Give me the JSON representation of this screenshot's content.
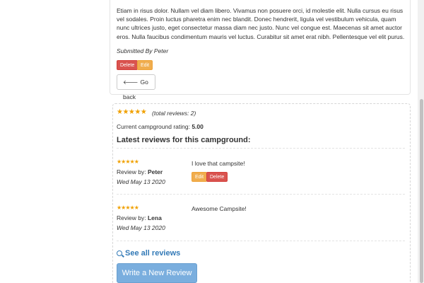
{
  "campground": {
    "description": "Etiam in risus dolor. Nullam vel diam libero. Vivamus non posuere orci, id molestie elit. Nulla cursus eu risus vel sodales. Proin luctus pharetra enim nec blandit. Donec hendrerit, ligula vel vestibulum vehicula, quam nunc ultrices justo, eget consectetur massa diam nec justo. Nunc vel congue est. Maecenas sit amet auctor eros. Nulla faucibus condimentum mauris vel luctus. Curabitur sit amet erat nibh. Pellentesque vel elit purus.",
    "submitted_by": "Submitted By Peter",
    "delete_label": "Delete",
    "edit_label": "Edit",
    "go_back_label": "Go back"
  },
  "reviews_section": {
    "stars": "★★★★★",
    "total_reviews": "(total reviews: 2)",
    "current_rating_label": "Current campground rating:",
    "current_rating_value": "5.00",
    "latest_heading": "Latest reviews for this campground:",
    "reviews": [
      {
        "stars": "★★★★★",
        "review_by_label": "Review by:",
        "author": "Peter",
        "date": "Wed May 13 2020",
        "text": "I love that campsite!",
        "edit_label": "Edit",
        "delete_label": "Delete"
      },
      {
        "stars": "★★★★★",
        "review_by_label": "Review by:",
        "author": "Lena",
        "date": "Wed May 13 2020",
        "text": "Awesome Campsite!"
      }
    ],
    "see_all_label": "See all reviews",
    "write_review_label": "Write a New Review"
  },
  "colors": {
    "danger": "#d9534f",
    "warning": "#f0ad4e",
    "link": "#337ab7",
    "star": "#f0a000",
    "primary_button": "#7aaede"
  }
}
